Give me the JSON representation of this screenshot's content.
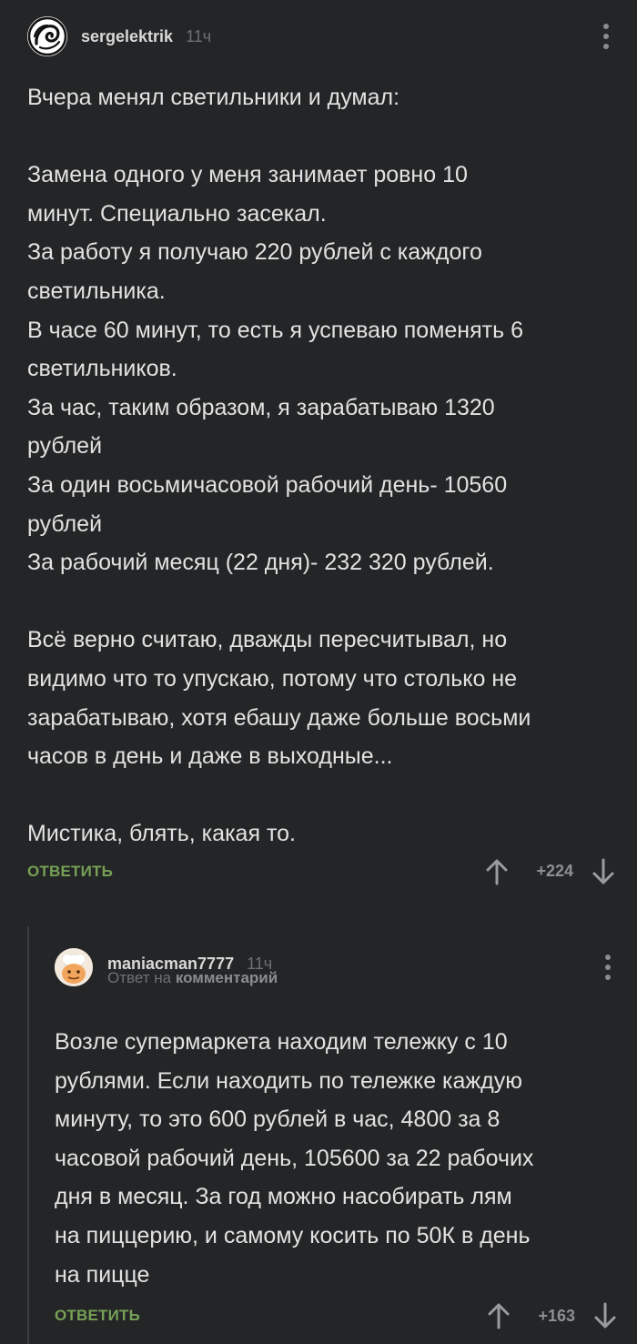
{
  "comments": {
    "root": {
      "username": "sergelektrik",
      "time": "11ч",
      "text": "Вчера менял светильники и думал:\n\nЗамена одного у меня занимает ровно 10\nминут. Специально засекал.\nЗа работу я получаю 220 рублей с каждого\nсветильника.\nВ часе 60 минут, то есть я успеваю поменять 6\nсветильников.\nЗа час, таким образом, я зарабатываю 1320\nрублей\nЗа один восьмичасовой рабочий день- 10560\nрублей\nЗа рабочий месяц (22 дня)- 232 320 рублей.\n\nВсё верно считаю, дважды пересчитывал, но\nвидимо что то упускаю, потому что столько не\nзарабатываю, хотя ебашу даже больше восьми\nчасов в день и даже в выходные...\n\nМистика, блять, какая то.",
      "reply_label": "ОТВЕТИТЬ",
      "rating": "+224"
    },
    "reply": {
      "username": "maniacman7777",
      "time": "11ч",
      "reply_to_prefix": "Ответ на",
      "reply_to_target": "комментарий",
      "text": "Возле супермаркета находим тележку с 10\nрублями. Если находить по тележке каждую\nминуту, то это 600 рублей в час, 4800 за 8\nчасовой рабочий день, 105600 за 22 рабочих\nдня в месяц. За год можно насобирать лям\nна пиццерию, и самому косить по 50К в день\nна пицце",
      "reply_label": "ОТВЕТИТЬ",
      "rating": "+163"
    }
  },
  "icons": {
    "more": "more-vertical-icon",
    "upvote": "arrow-up-icon",
    "downvote": "arrow-down-icon"
  },
  "colors": {
    "background": "#242526",
    "accent": "#76a155",
    "text": "#e2e2e2",
    "muted": "#6e7073"
  }
}
